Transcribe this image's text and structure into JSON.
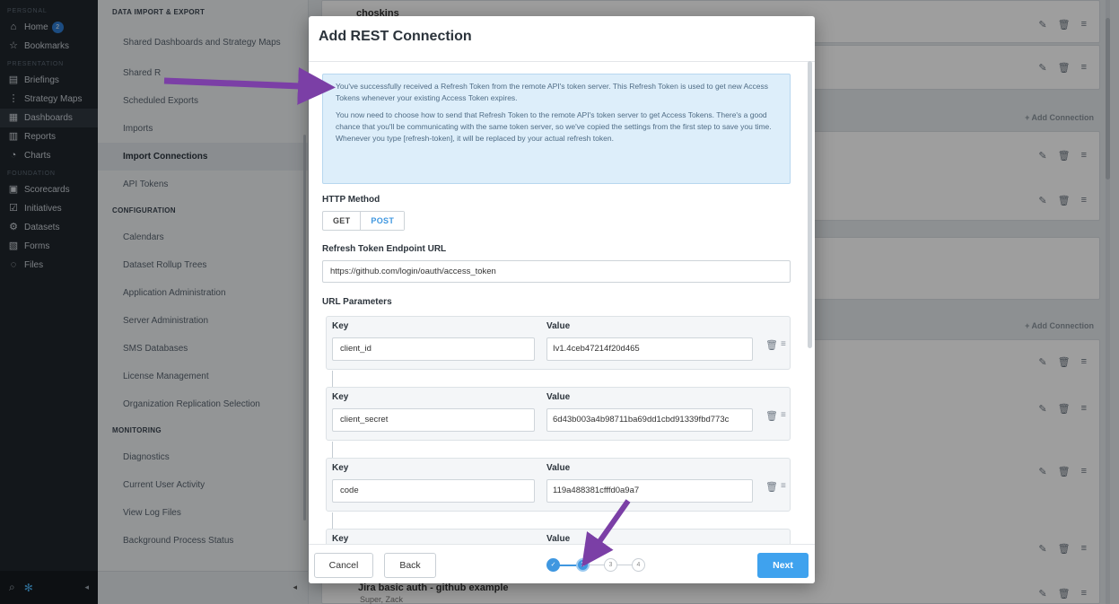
{
  "nav": {
    "personal_label": "PERSONAL",
    "home_label": "Home",
    "home_badge": "2",
    "bookmarks_label": "Bookmarks",
    "presentation_label": "PRESENTATION",
    "briefings_label": "Briefings",
    "strategy_maps_label": "Strategy Maps",
    "dashboards_label": "Dashboards",
    "reports_label": "Reports",
    "charts_label": "Charts",
    "foundation_label": "FOUNDATION",
    "scorecards_label": "Scorecards",
    "initiatives_label": "Initiatives",
    "datasets_label": "Datasets",
    "forms_label": "Forms",
    "files_label": "Files"
  },
  "settings": {
    "section_data": "DATA IMPORT & EXPORT",
    "shared_dashboards": "Shared Dashboards and Strategy Maps",
    "shared_r": "Shared R",
    "scheduled_exports": "Scheduled Exports",
    "imports": "Imports",
    "import_connections": "Import Connections",
    "api_tokens": "API Tokens",
    "section_config": "CONFIGURATION",
    "calendars": "Calendars",
    "dataset_rollup": "Dataset Rollup Trees",
    "app_admin": "Application Administration",
    "server_admin": "Server Administration",
    "sms_databases": "SMS Databases",
    "license_mgmt": "License Management",
    "org_replication": "Organization Replication Selection",
    "section_monitoring": "MONITORING",
    "diagnostics": "Diagnostics",
    "current_user_activity": "Current User Activity",
    "view_log_files": "View Log Files",
    "background_status": "Background Process Status"
  },
  "background": {
    "top_item": "choskins",
    "add_connection": "Add Connection",
    "bottom_item": "Jira basic auth - github example",
    "bottom_sub": "Super, Zack"
  },
  "modal": {
    "title": "Add REST Connection",
    "info_p1": "You've successfully received a Refresh Token from the remote API's token server. This Refresh Token is used to get new Access Tokens whenever your existing Access Token expires.",
    "info_p2": "You now need to choose how to send that Refresh Token to the remote API's token server to get Access Tokens. There's a good chance that you'll be communicating with the same token server, so we've copied the settings from the first step to save you time. Whenever you type [refresh-token], it will be replaced by your actual refresh token.",
    "http_method_label": "HTTP Method",
    "get_label": "GET",
    "post_label": "POST",
    "endpoint_label": "Refresh Token Endpoint URL",
    "endpoint_value": "https://github.com/login/oauth/access_token",
    "url_params_label": "URL Parameters",
    "key_label": "Key",
    "value_label": "Value",
    "params": [
      {
        "key": "client_id",
        "value": "Iv1.4ceb47214f20d465"
      },
      {
        "key": "client_secret",
        "value": "6d43b003a4b98711ba69dd1cbd91339fbd773c"
      },
      {
        "key": "code",
        "value": "119a488381cfffd0a9a7"
      }
    ],
    "cancel_label": "Cancel",
    "back_label": "Back",
    "next_label": "Next",
    "steps": [
      "✓",
      "2",
      "3",
      "4"
    ],
    "current_step": 2
  },
  "colors": {
    "accent": "#3f97e0",
    "annotation_arrow": "#7b3fa6"
  }
}
